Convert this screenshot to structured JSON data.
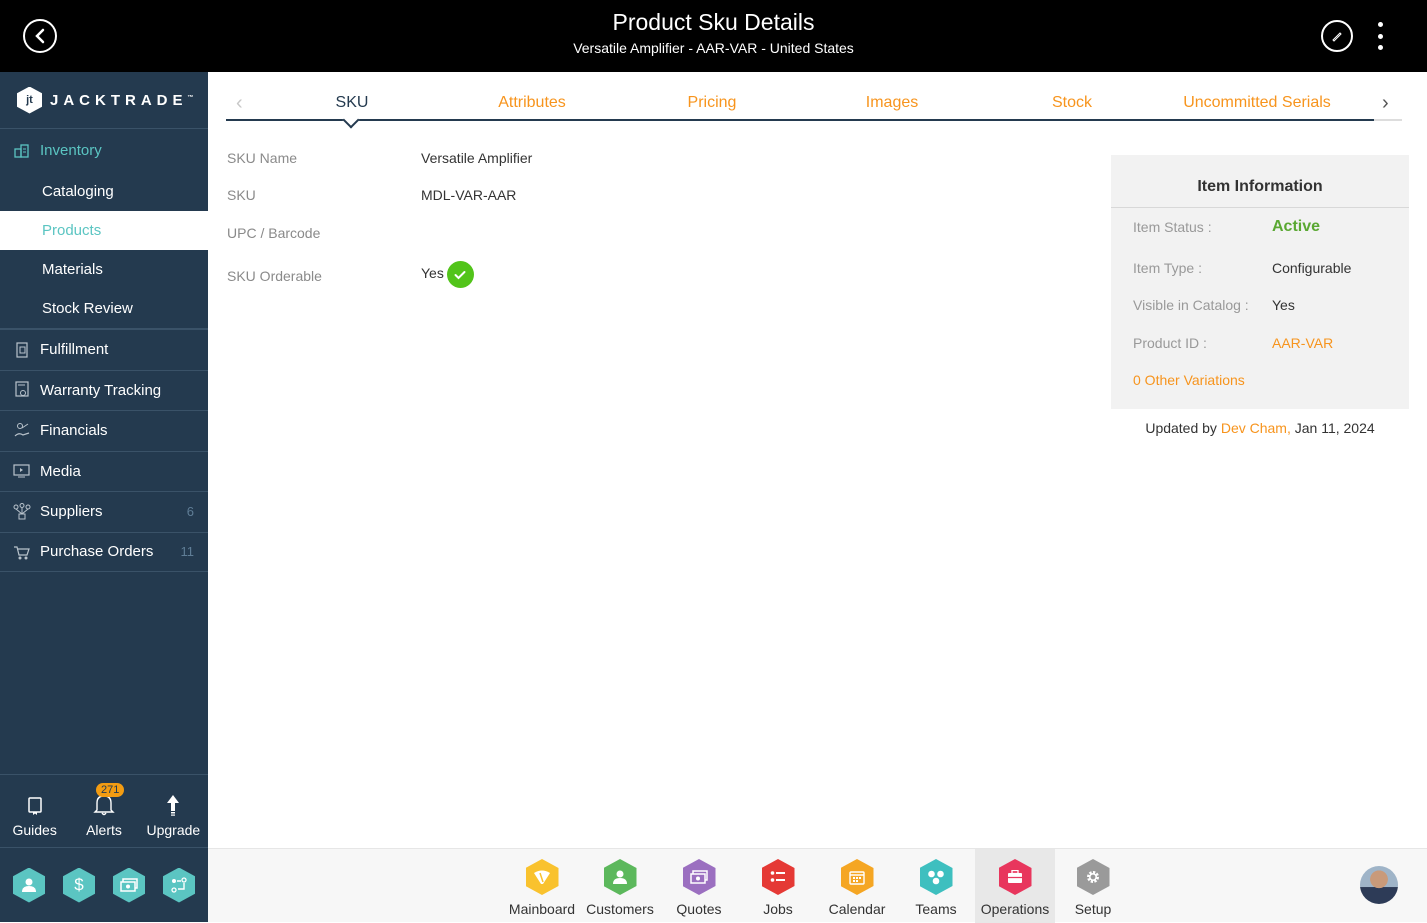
{
  "header": {
    "title": "Product Sku Details",
    "subtitle": "Versatile Amplifier - AAR-VAR - United States"
  },
  "sidebar": {
    "logo_text": "JACKTRADE",
    "logo_tm": "™",
    "group": {
      "label": "Inventory",
      "icon": "inventory-icon"
    },
    "sub_items": [
      {
        "label": "Cataloging",
        "active": false
      },
      {
        "label": "Products",
        "active": true
      },
      {
        "label": "Materials",
        "active": false
      },
      {
        "label": "Stock Review",
        "active": false
      }
    ],
    "items": [
      {
        "label": "Fulfillment",
        "icon": "fulfillment-icon",
        "count": ""
      },
      {
        "label": "Warranty Tracking",
        "icon": "warranty-icon",
        "count": ""
      },
      {
        "label": "Financials",
        "icon": "financials-icon",
        "count": ""
      },
      {
        "label": "Media",
        "icon": "media-icon",
        "count": ""
      },
      {
        "label": "Suppliers",
        "icon": "suppliers-icon",
        "count": "6"
      },
      {
        "label": "Purchase Orders",
        "icon": "purchase-orders-icon",
        "count": "11"
      }
    ],
    "tools": [
      {
        "label": "Guides",
        "icon": "book-icon"
      },
      {
        "label": "Alerts",
        "icon": "bell-icon",
        "badge": "271"
      },
      {
        "label": "Upgrade",
        "icon": "arrow-up-icon"
      }
    ],
    "apps": [
      {
        "icon": "user-icon"
      },
      {
        "icon": "dollar-icon"
      },
      {
        "icon": "money-icon"
      },
      {
        "icon": "workflow-icon"
      }
    ],
    "accent": "#5bc5c2"
  },
  "tabs": {
    "items": [
      {
        "label": "SKU",
        "active": true
      },
      {
        "label": "Attributes",
        "active": false
      },
      {
        "label": "Pricing",
        "active": false
      },
      {
        "label": "Images",
        "active": false
      },
      {
        "label": "Stock",
        "active": false
      },
      {
        "label": "Uncommitted Serials",
        "active": false
      }
    ]
  },
  "sku": {
    "fields": [
      {
        "label": "SKU Name",
        "value": "Versatile Amplifier"
      },
      {
        "label": "SKU",
        "value": "MDL-VAR-AAR"
      },
      {
        "label": "UPC / Barcode",
        "value": ""
      },
      {
        "label": "SKU Orderable",
        "value": "Yes"
      }
    ]
  },
  "item_info": {
    "title": "Item Information",
    "rows": [
      {
        "label": "Item Status :",
        "value": "Active"
      },
      {
        "label": "Item Type :",
        "value": "Configurable"
      },
      {
        "label": "Visible in Catalog :",
        "value": "Yes"
      },
      {
        "label": "Product ID :",
        "value": "AAR-VAR"
      }
    ],
    "variations_link": "0 Other Variations",
    "updated_prefix": "Updated by",
    "updated_by": "Dev Cham,",
    "updated_date": "Jan 11, 2024",
    "status_color": "#5aa832"
  },
  "dock": {
    "items": [
      {
        "label": "Mainboard",
        "icon": "mainboard-icon",
        "color": "#f9c22e",
        "active": false
      },
      {
        "label": "Customers",
        "icon": "customers-icon",
        "color": "#5cb85c",
        "active": false
      },
      {
        "label": "Quotes",
        "icon": "quotes-icon",
        "color": "#9b6fc0",
        "active": false
      },
      {
        "label": "Jobs",
        "icon": "jobs-icon",
        "color": "#e53935",
        "active": false
      },
      {
        "label": "Calendar",
        "icon": "calendar-icon",
        "color": "#f5a623",
        "active": false
      },
      {
        "label": "Teams",
        "icon": "teams-icon",
        "color": "#3ebfbf",
        "active": false
      },
      {
        "label": "Operations",
        "icon": "operations-icon",
        "color": "#e8365d",
        "active": true
      },
      {
        "label": "Setup",
        "icon": "setup-icon",
        "color": "#9a9a9a",
        "active": false
      }
    ]
  },
  "colors": {
    "orange": "#f7941d",
    "navy": "#243a4f"
  }
}
